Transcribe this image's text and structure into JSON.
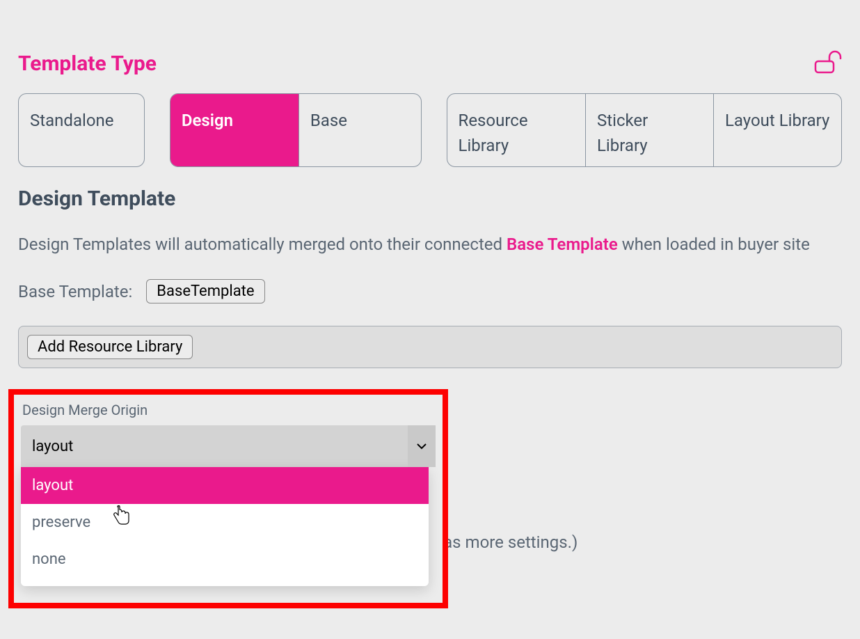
{
  "header": {
    "title": "Template Type",
    "lock_icon": "unlock-icon"
  },
  "type_groups": {
    "group1": [
      {
        "label": "Standalone",
        "selected": false
      }
    ],
    "group2": [
      {
        "label": "Design",
        "selected": true
      },
      {
        "label": "Base",
        "selected": false
      }
    ],
    "group3": [
      {
        "label": "Resource Library",
        "selected": false
      },
      {
        "label": "Sticker Library",
        "selected": false
      },
      {
        "label": "Layout Library",
        "selected": false
      }
    ]
  },
  "subheading": "Design Template",
  "description": {
    "pre": "Design Templates will automatically merged onto their connected ",
    "link": "Base Template",
    "post": " when loaded in buyer site"
  },
  "base_template": {
    "label": "Base Template:",
    "button": "BaseTemplate"
  },
  "resource_bar": {
    "button": "Add Resource Library"
  },
  "design_merge": {
    "label": "Design Merge Origin",
    "selected": "layout",
    "options": [
      "layout",
      "preserve",
      "none"
    ]
  },
  "behind_text": "Has more settings.)"
}
